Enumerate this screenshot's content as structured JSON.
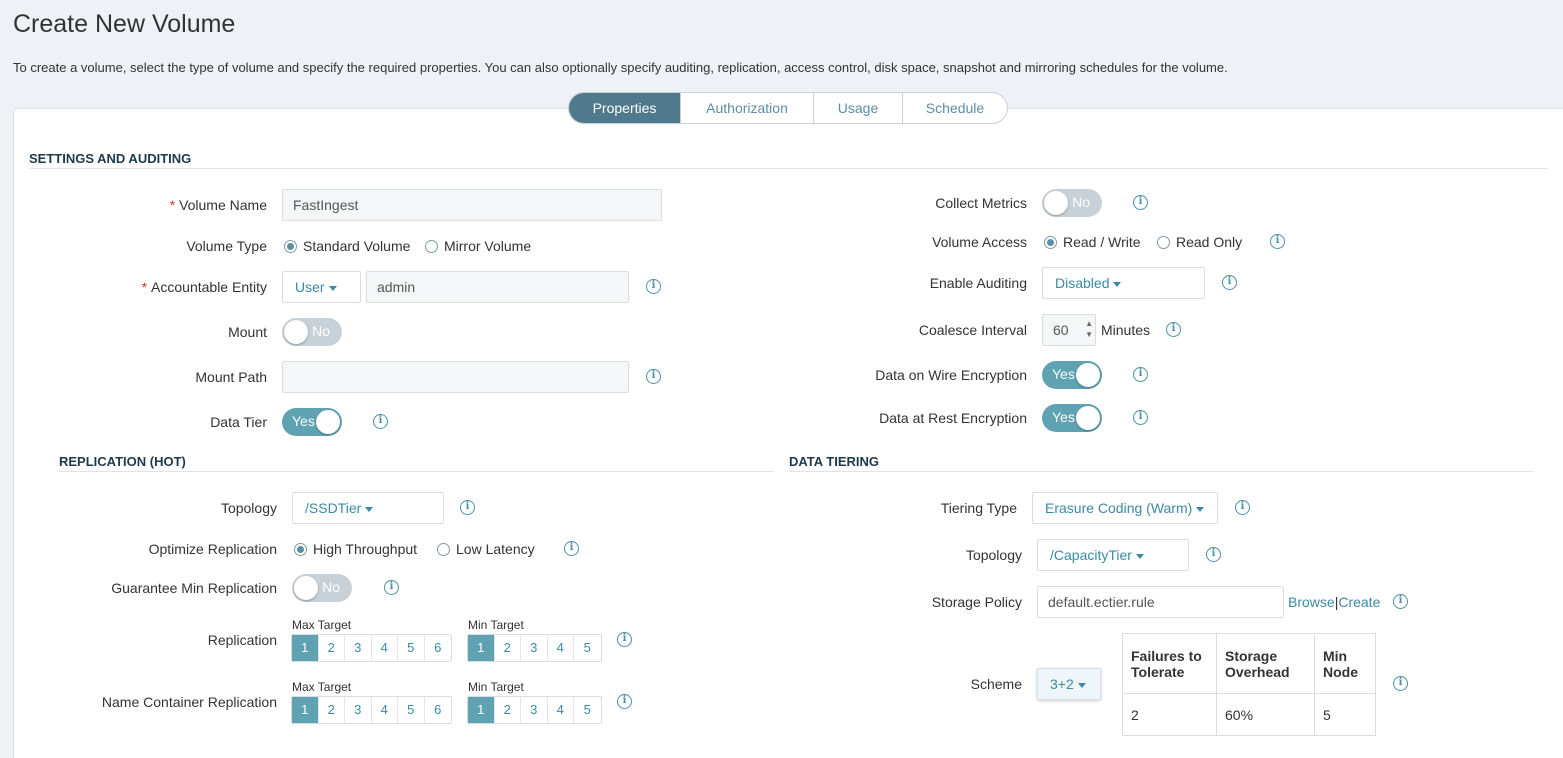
{
  "page": {
    "title": "Create New Volume",
    "description": "To create a volume, select the type of volume and specify the required properties. You can also optionally specify auditing, replication, access control, disk space, snapshot and mirroring schedules for the volume."
  },
  "tabs": [
    "Properties",
    "Authorization",
    "Usage",
    "Schedule"
  ],
  "active_tab": "Properties",
  "settings": {
    "title": "SETTINGS AND AUDITING",
    "volume_name_label": "Volume Name",
    "volume_name_value": "FastIngest",
    "volume_type_label": "Volume Type",
    "volume_type_opt1": "Standard Volume",
    "volume_type_opt2": "Mirror Volume",
    "accountable_label": "Accountable Entity",
    "accountable_type": "User",
    "accountable_value": "admin",
    "mount_label": "Mount",
    "mount_value": "No",
    "mount_path_label": "Mount Path",
    "mount_path_value": "",
    "data_tier_label": "Data Tier",
    "data_tier_value": "Yes",
    "collect_metrics_label": "Collect Metrics",
    "collect_metrics_value": "No",
    "volume_access_label": "Volume Access",
    "volume_access_opt1": "Read / Write",
    "volume_access_opt2": "Read Only",
    "auditing_label": "Enable Auditing",
    "auditing_value": "Disabled",
    "coalesce_label": "Coalesce Interval",
    "coalesce_value": "60",
    "coalesce_unit": "Minutes",
    "wire_enc_label": "Data on Wire Encryption",
    "wire_enc_value": "Yes",
    "rest_enc_label": "Data at Rest Encryption",
    "rest_enc_value": "Yes"
  },
  "replication": {
    "title": "REPLICATION (HOT)",
    "topology_label": "Topology",
    "topology_value": "/SSDTier",
    "optimize_label": "Optimize Replication",
    "optimize_opt1": "High Throughput",
    "optimize_opt2": "Low Latency",
    "guarantee_label": "Guarantee Min Replication",
    "guarantee_value": "No",
    "replication_label": "Replication",
    "name_container_label": "Name Container Replication",
    "max_target_label": "Max Target",
    "min_target_label": "Min Target",
    "max_options": [
      "1",
      "2",
      "3",
      "4",
      "5",
      "6"
    ],
    "min_options": [
      "1",
      "2",
      "3",
      "4",
      "5"
    ],
    "replication_max_selected": 1,
    "replication_min_selected": 1,
    "name_container_max_selected": 1,
    "name_container_min_selected": 1
  },
  "tiering": {
    "title": "DATA TIERING",
    "type_label": "Tiering Type",
    "type_value": "Erasure Coding (Warm)",
    "topology_label": "Topology",
    "topology_value": "/CapacityTier",
    "policy_label": "Storage Policy",
    "policy_value": "default.ectier.rule",
    "browse_link": "Browse",
    "separator": "|",
    "create_link": "Create",
    "scheme_label": "Scheme",
    "scheme_value": "3+2",
    "table_headers": [
      "Failures to Tolerate",
      "Storage Overhead",
      "Min Node"
    ],
    "table_row": [
      "2",
      "60%",
      "5"
    ]
  },
  "colors": {
    "accent": "#4f7a8c",
    "toggle_on": "#5fa3b3",
    "link": "#3b8aa3",
    "required": "#c0392b"
  }
}
